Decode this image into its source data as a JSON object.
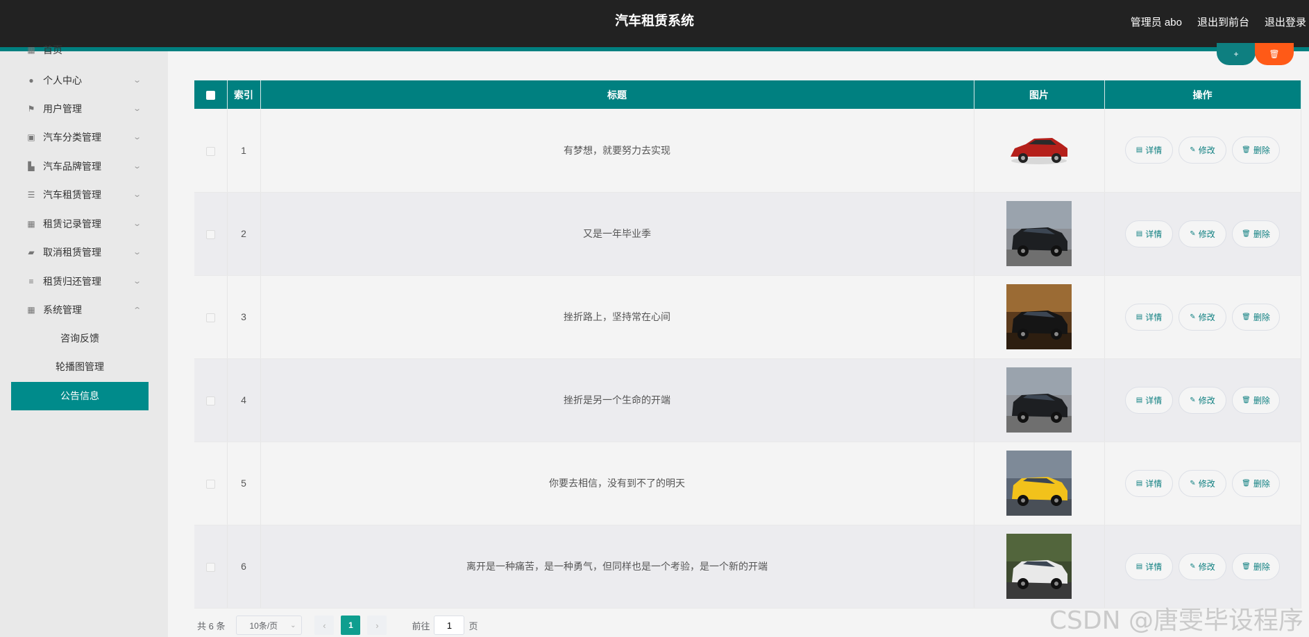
{
  "header": {
    "title": "汽车租赁系统",
    "user": "管理员 abo",
    "to_front": "退出到前台",
    "logout": "退出登录"
  },
  "sidebar": {
    "items": [
      {
        "label": "首页",
        "icon": "home-icon"
      },
      {
        "label": "个人中心",
        "icon": "user-icon"
      },
      {
        "label": "用户管理",
        "icon": "flag-icon"
      },
      {
        "label": "汽车分类管理",
        "icon": "clipboard-icon"
      },
      {
        "label": "汽车品牌管理",
        "icon": "badge-icon"
      },
      {
        "label": "汽车租赁管理",
        "icon": "sliders-icon"
      },
      {
        "label": "租赁记录管理",
        "icon": "grid-icon"
      },
      {
        "label": "取消租赁管理",
        "icon": "ticket-icon"
      },
      {
        "label": "租赁归还管理",
        "icon": "list-icon"
      },
      {
        "label": "系统管理",
        "icon": "grid-icon"
      }
    ],
    "sub_items": [
      {
        "label": "咨询反馈"
      },
      {
        "label": "轮播图管理"
      },
      {
        "label": "公告信息",
        "active": true
      }
    ]
  },
  "actions": {
    "add_label": "+",
    "delete_label": "🗑"
  },
  "table": {
    "columns": [
      "索引",
      "标题",
      "图片",
      "操作"
    ],
    "rows": [
      {
        "index": "1",
        "title": "有梦想，就要努力去实现",
        "image": "red-suv"
      },
      {
        "index": "2",
        "title": "又是一年毕业季",
        "image": "black-suv"
      },
      {
        "index": "3",
        "title": "挫折路上，坚持常在心间",
        "image": "black-sports-car"
      },
      {
        "index": "4",
        "title": "挫折是另一个生命的开端",
        "image": "black-suv"
      },
      {
        "index": "5",
        "title": "你要去相信，没有到不了的明天",
        "image": "yellow-supercar"
      },
      {
        "index": "6",
        "title": "离开是一种痛苦，是一种勇气，但同样也是一个考验，是一个新的开端",
        "image": "white-suv"
      }
    ],
    "op_labels": {
      "detail": "详情",
      "edit": "修改",
      "delete": "删除"
    }
  },
  "pagination": {
    "total": "共 6 条",
    "page_size": "10条/页",
    "current_page": "1",
    "goto_label": "前往",
    "goto_value": "1",
    "goto_suffix": "页"
  },
  "watermark": "CSDN @唐雯毕设程序",
  "colors": {
    "primary": "#008080",
    "danger": "#ff5a17",
    "topbar": "#222222"
  }
}
